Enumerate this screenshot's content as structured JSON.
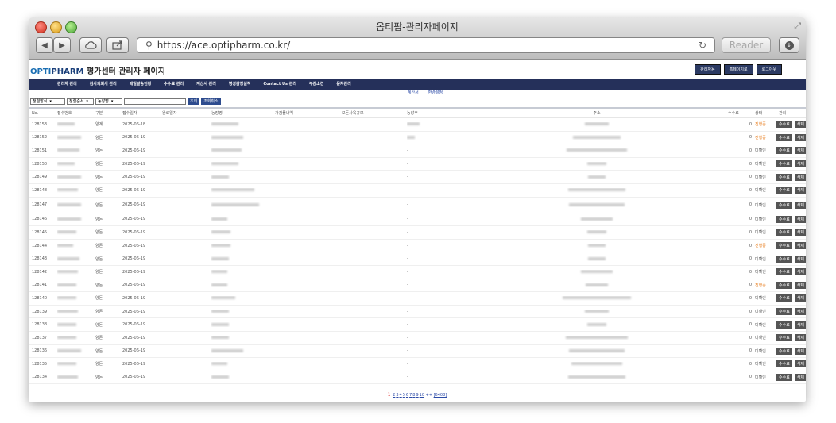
{
  "window": {
    "title": "옵티팜-관리자페이지",
    "url": "https://ace.optipharm.co.kr/",
    "reader_label": "Reader"
  },
  "header": {
    "logo_opti": "OPTI",
    "logo_pharm": "PHARM",
    "logo_rest": " 평가센터 관리자 페이지",
    "buttons": [
      "관리자용",
      "홈페이지로",
      "로그아웃"
    ]
  },
  "nav": {
    "items": [
      "관리자 관리",
      "검사의뢰서 관리",
      "메일발송현황",
      "수수료 관리",
      "계산서 관리",
      "병성감정실적",
      "Contact Us 관리",
      "부검소견",
      "문자관리"
    ]
  },
  "subnav": {
    "items": [
      "계산서",
      "환경설정"
    ]
  },
  "filter": {
    "select1": "정렬방식",
    "select2": "정렬순서",
    "select3": "농장명",
    "search_btn": "조회",
    "reset_btn": "조회취소"
  },
  "table": {
    "headers": [
      "No.",
      "접수번호",
      "구분",
      "접수일자",
      "완료일자",
      "농장명",
      "가검물내역",
      "모돈사육규모",
      "농장주",
      "주소",
      "수수료",
      "상태",
      "관리"
    ],
    "edit_label": "수수료",
    "delete_label": "삭제",
    "rows": [
      {
        "no": "128153",
        "type": "양계",
        "date": "2025-06-18",
        "fee": "0",
        "status": "진행중",
        "owner_dash": ""
      },
      {
        "no": "128152",
        "type": "양돈",
        "date": "2025-06-19",
        "fee": "0",
        "status": "진행중",
        "owner_dash": ""
      },
      {
        "no": "128151",
        "type": "양돈",
        "date": "2025-06-19",
        "fee": "0",
        "status": "미확인",
        "owner_dash": "-"
      },
      {
        "no": "128150",
        "type": "양돈",
        "date": "2025-06-19",
        "fee": "0",
        "status": "미확인",
        "owner_dash": "-"
      },
      {
        "no": "128149",
        "type": "양돈",
        "date": "2025-06-19",
        "fee": "0",
        "status": "미확인",
        "owner_dash": "-"
      },
      {
        "no": "128148",
        "type": "양돈",
        "date": "2025-06-19",
        "fee": "0",
        "status": "미확인",
        "owner_dash": "-"
      },
      {
        "no": "128147",
        "type": "양돈",
        "date": "2025-06-19",
        "fee": "0",
        "status": "미확인",
        "owner_dash": "-"
      },
      {
        "no": "128146",
        "type": "양돈",
        "date": "2025-06-19",
        "fee": "0",
        "status": "미확인",
        "owner_dash": "-"
      },
      {
        "no": "128145",
        "type": "양돈",
        "date": "2025-06-19",
        "fee": "0",
        "status": "미확인",
        "owner_dash": "-"
      },
      {
        "no": "128144",
        "type": "양돈",
        "date": "2025-06-19",
        "fee": "0",
        "status": "진행중",
        "owner_dash": "-"
      },
      {
        "no": "128143",
        "type": "양돈",
        "date": "2025-06-19",
        "fee": "0",
        "status": "미확인",
        "owner_dash": "-"
      },
      {
        "no": "128142",
        "type": "양돈",
        "date": "2025-06-19",
        "fee": "0",
        "status": "미확인",
        "owner_dash": "-"
      },
      {
        "no": "128141",
        "type": "양돈",
        "date": "2025-06-19",
        "fee": "0",
        "status": "진행중",
        "owner_dash": "-"
      },
      {
        "no": "128140",
        "type": "양돈",
        "date": "2025-06-19",
        "fee": "0",
        "status": "미확인",
        "owner_dash": "-"
      },
      {
        "no": "128139",
        "type": "양돈",
        "date": "2025-06-19",
        "fee": "0",
        "status": "미확인",
        "owner_dash": "-"
      },
      {
        "no": "128138",
        "type": "양돈",
        "date": "2025-06-19",
        "fee": "0",
        "status": "미확인",
        "owner_dash": "-"
      },
      {
        "no": "128137",
        "type": "양돈",
        "date": "2025-06-19",
        "fee": "0",
        "status": "미확인",
        "owner_dash": "-"
      },
      {
        "no": "128136",
        "type": "양돈",
        "date": "2025-06-19",
        "fee": "0",
        "status": "미확인",
        "owner_dash": "-"
      },
      {
        "no": "128135",
        "type": "양돈",
        "date": "2025-06-19",
        "fee": "0",
        "status": "미확인",
        "owner_dash": "-"
      },
      {
        "no": "128134",
        "type": "양돈",
        "date": "2025-06-19",
        "fee": "0",
        "status": "미확인",
        "owner_dash": "-"
      }
    ]
  },
  "pager": {
    "current": "1",
    "pages": [
      "2",
      "3",
      "4",
      "5",
      "6",
      "7",
      "8",
      "9",
      "10"
    ],
    "next": "++",
    "last": "[6408]"
  },
  "colors": {
    "nav_bg": "#25305a",
    "status_progress": "#e87c1c",
    "action_btn": "#555555"
  }
}
